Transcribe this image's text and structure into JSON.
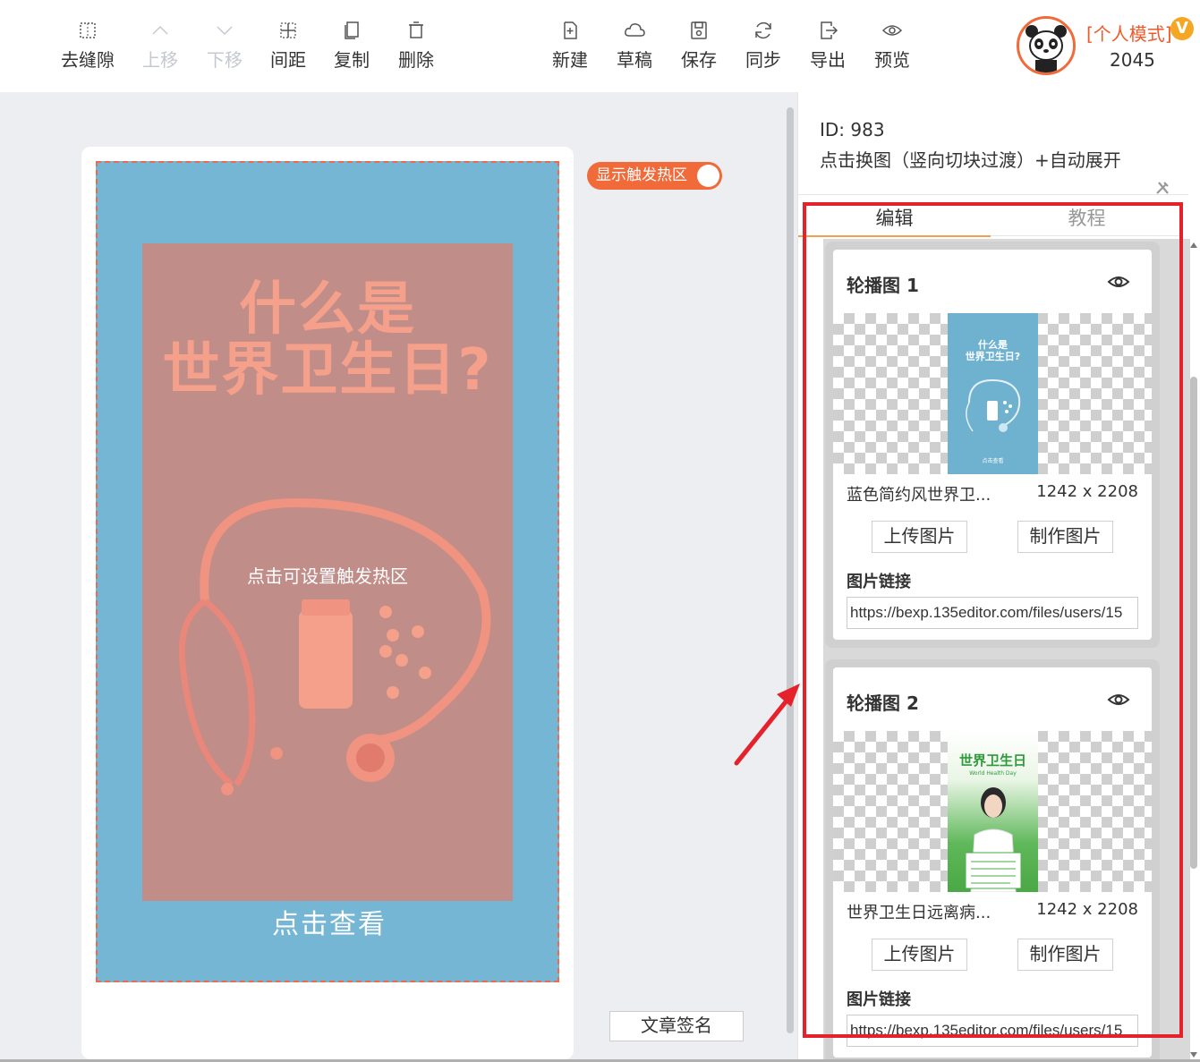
{
  "toolbar": {
    "left_tools": [
      {
        "label": "去缝隙",
        "icon": "gap-icon"
      },
      {
        "label": "上移",
        "icon": "chevron-up-icon"
      },
      {
        "label": "下移",
        "icon": "chevron-down-icon"
      },
      {
        "label": "间距",
        "icon": "spacing-icon"
      },
      {
        "label": "复制",
        "icon": "copy-icon"
      },
      {
        "label": "删除",
        "icon": "trash-icon"
      }
    ],
    "right_tools": [
      {
        "label": "新建",
        "icon": "new-file-icon"
      },
      {
        "label": "草稿",
        "icon": "cloud-icon"
      },
      {
        "label": "保存",
        "icon": "save-icon"
      },
      {
        "label": "同步",
        "icon": "sync-icon"
      },
      {
        "label": "导出",
        "icon": "export-icon"
      },
      {
        "label": "预览",
        "icon": "eye-icon"
      }
    ],
    "user": {
      "mode": "[个人模式]",
      "vip_badge": "V",
      "id": "2045"
    }
  },
  "canvas": {
    "hotzone_toggle": "显示触发热区",
    "poster": {
      "title_line1": "什么是",
      "title_line2": "世界卫生日?",
      "hotzone_hint": "点击可设置触发热区",
      "view_link": "点击查看"
    },
    "signature_button": "文章签名"
  },
  "panel": {
    "id_text": "ID: 983",
    "component_name": "点击换图（竖向切块过渡）+自动展开",
    "tabs": [
      {
        "label": "编辑",
        "active": true
      },
      {
        "label": "教程",
        "active": false
      }
    ],
    "carousel": [
      {
        "title": "轮播图 1",
        "file_name": "蓝色简约风世界卫...",
        "size": "1242 x 2208",
        "upload_btn": "上传图片",
        "make_btn": "制作图片",
        "link_label": "图片链接",
        "link_value": "https://bexp.135editor.com/files/users/15",
        "thumb_title1": "什么是",
        "thumb_title2": "世界卫生日?",
        "thumb_footer": "点击查看"
      },
      {
        "title": "轮播图 2",
        "file_name": "世界卫生日远离病...",
        "size": "1242 x 2208",
        "upload_btn": "上传图片",
        "make_btn": "制作图片",
        "link_label": "图片链接",
        "link_value": "https://bexp.135editor.com/files/users/15",
        "thumb_title1": "世界卫生日",
        "thumb_subtitle": "World Health Day"
      }
    ]
  },
  "colors": {
    "accent": "#f06a3a",
    "annotation_red": "#e5222b",
    "poster_blue": "#74b6d4",
    "poster_pink": "#c08d89",
    "title_salmon": "#f4a08a"
  }
}
